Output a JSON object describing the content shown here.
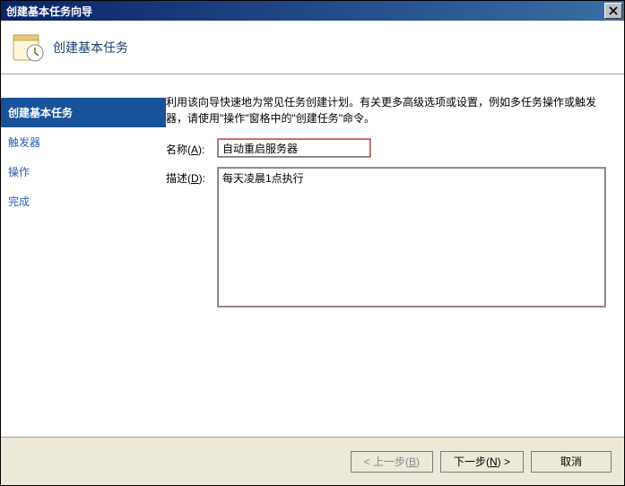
{
  "window": {
    "title": "创建基本任务向导"
  },
  "header": {
    "title": "创建基本任务"
  },
  "sidebar": {
    "items": [
      {
        "label": "创建基本任务",
        "active": true
      },
      {
        "label": "触发器",
        "active": false
      },
      {
        "label": "操作",
        "active": false
      },
      {
        "label": "完成",
        "active": false
      }
    ]
  },
  "main": {
    "description": "利用该向导快速地为常见任务创建计划。有关更多高级选项或设置，例如多任务操作或触发器，请使用\"操作\"窗格中的\"创建任务\"命令。",
    "name_label_prefix": "名称(",
    "name_label_hotkey": "A",
    "name_label_suffix": "):",
    "name_value": "自动重启服务器",
    "desc_label_prefix": "描述(",
    "desc_label_hotkey": "D",
    "desc_label_suffix": "):",
    "desc_value": "每天凌晨1点执行"
  },
  "footer": {
    "back_prefix": "< 上一步(",
    "back_hotkey": "B",
    "back_suffix": ")",
    "next_prefix": "下一步(",
    "next_hotkey": "N",
    "next_suffix": ") >",
    "cancel": "取消"
  }
}
